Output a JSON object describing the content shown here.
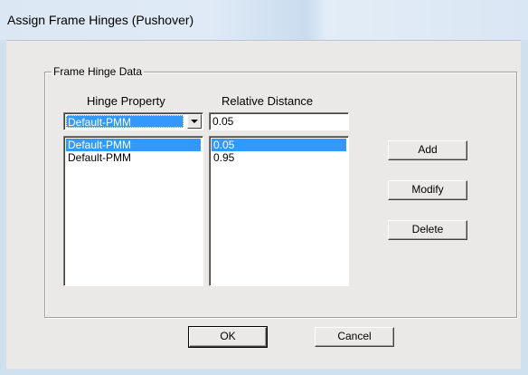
{
  "window": {
    "title": "Assign Frame Hinges (Pushover)"
  },
  "group": {
    "title": "Frame Hinge Data"
  },
  "columns": {
    "hinge_property": "Hinge Property",
    "relative_distance": "Relative Distance"
  },
  "hinge_property_select": {
    "value": "Default-PMM"
  },
  "relative_distance_input": {
    "value": "0.05"
  },
  "hinge_list": [
    "Default-PMM",
    "Default-PMM"
  ],
  "distance_list": [
    "0.05",
    "0.95"
  ],
  "buttons": {
    "add": "Add",
    "modify": "Modify",
    "delete": "Delete",
    "ok": "OK",
    "cancel": "Cancel"
  },
  "colors": {
    "selection": "#3399ff",
    "dialog_bg": "#ebe9e8",
    "frame_bg": "#cfe0ef"
  }
}
